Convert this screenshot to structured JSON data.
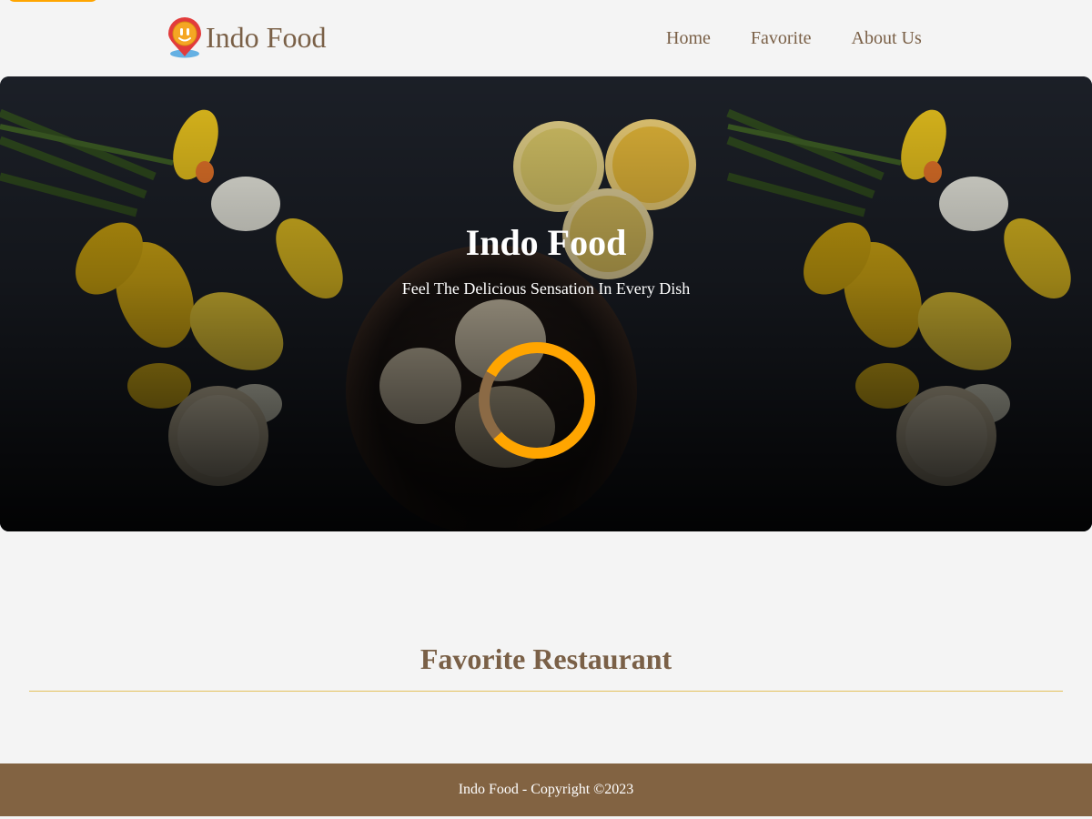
{
  "header": {
    "brand_name": "Indo Food",
    "logo_icon": "location-pin-smile-icon",
    "nav": [
      {
        "label": "Home"
      },
      {
        "label": "Favorite"
      },
      {
        "label": "About Us"
      }
    ]
  },
  "hero": {
    "title": "Indo Food",
    "tagline": "Feel The Delicious Sensation In Every Dish",
    "loader_icon": "loading-spinner-icon",
    "loader_progress_fraction": 0.8
  },
  "content": {
    "title": "Favorite Restaurant"
  },
  "footer": {
    "text": "Indo Food - Copyright ©2023"
  },
  "colors": {
    "brand_brown": "#7a6047",
    "footer_bg": "#826342",
    "accent_orange": "#ffa500",
    "divider_gold": "#e3c15c",
    "page_bg": "#f4f4f4"
  }
}
